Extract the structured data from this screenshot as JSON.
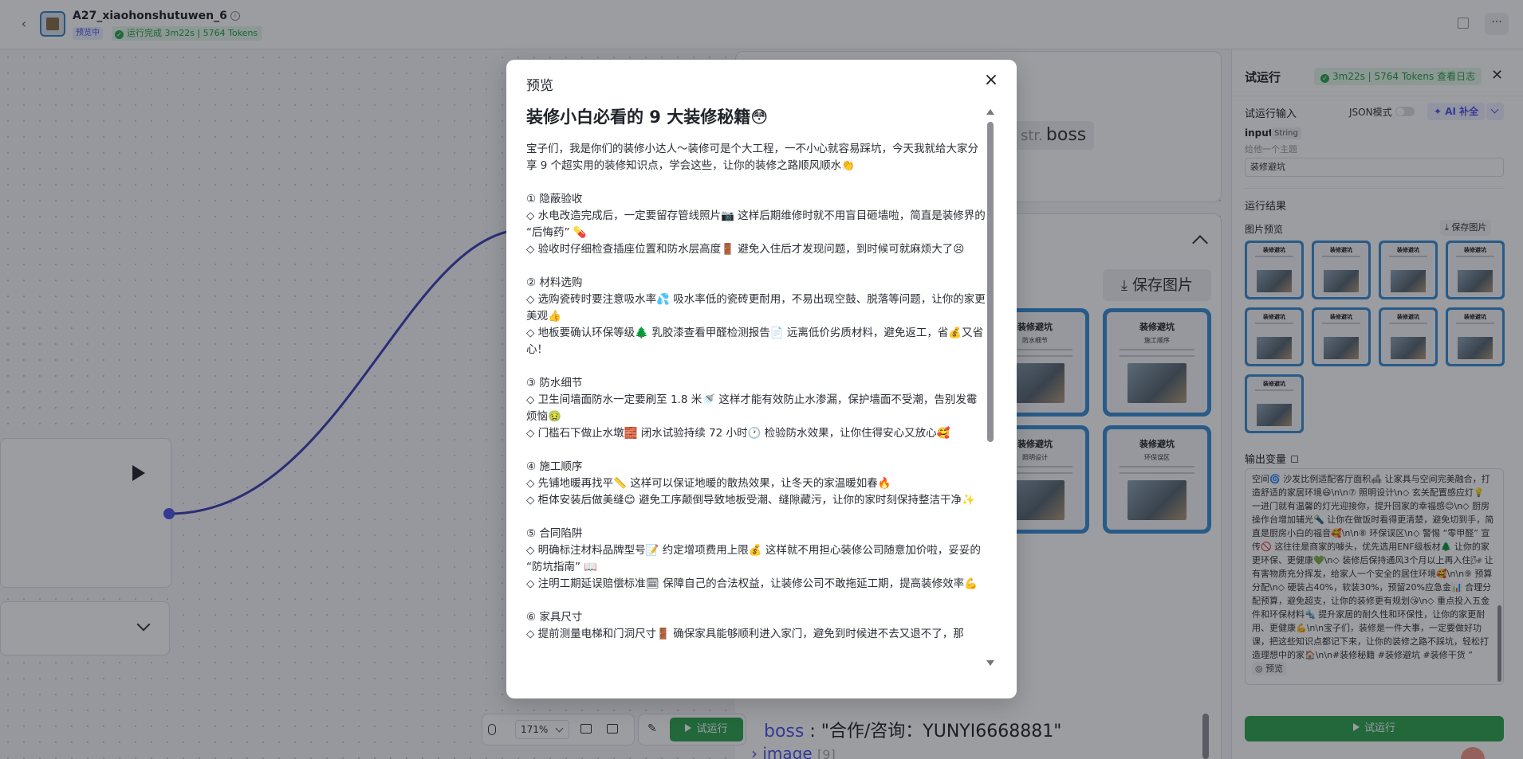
{
  "app": {
    "title": "A27_xiaohonshutuwen_6",
    "tag_preview": "预览中",
    "run_status": "运行完成 3m22s | 5764 Tokens"
  },
  "canvas": {
    "str_prefix": "str.",
    "str_value": "boss",
    "save_image_label": "保存图片",
    "boss_key": "boss",
    "boss_value": "\"合作/咨询：YUNYI6668881\"",
    "image_key": "image",
    "image_count": "[9]",
    "zoom": "171%",
    "run_label": "试运行",
    "thumb_title": "装修避坑",
    "thumbs": [
      {
        "sub": "防水细节"
      },
      {
        "sub": "施工顺序"
      },
      {
        "sub": "照明设计"
      },
      {
        "sub": "环保误区"
      }
    ]
  },
  "right_panel": {
    "title": "试运行",
    "badge": "3m22s | 5764 Tokens  查看日志",
    "input_label": "试运行输入",
    "json_mode": "JSON模式",
    "ai_button": "AI 补全",
    "var_name": "input",
    "var_type": "String",
    "var_hint": "给他一个主题",
    "var_value": "装修避坑",
    "result_title": "运行结果",
    "image_preview_label": "图片预览",
    "save_image_label": "保存图片",
    "thumb_title": "装修避坑",
    "output_var_label": "输出变量",
    "output_text": "空间🌀 沙发比例适配客厅面积🛋 让家具与空间完美融合，打造舒适的家居环境😄\\n\\n⑦ 照明设计\\n◇ 玄关配置感应灯💡 一进门就有温馨的灯光迎接你，提升回家的幸福感😊\\n◇ 厨房操作台增加辅光🔦 让你在做饭时看得更清楚，避免切到手，简直是厨房小白的福音🥰\\n\\n⑧ 环保误区\\n◇ 警惕 “零甲醛” 宣传🚫 这往往是商家的噱头，优先选用ENF级板材🌲 让你的家更环保、更健康💚\\n◇ 装修后保持通风3个月以上再入住🌬 让有害物质充分挥发，给家人一个安全的居住环境🥰\\n\\n⑨ 预算分配\\n◇ 硬装占40%，软装30%，预留20%应急金📊 合理分配预算，避免超支，让你的装修更有规划😘\\n◇ 重点投入五金件和环保材料🔩 提升家居的耐久性和环保性，让你的家更耐用、更健康💪\\n\\n宝子们，装修是一件大事，一定要做好功课，把这些知识点都记下来，让你的装修之路不踩坑，轻松打造理想中的家🏠\\n\\n#装修秘籍 #装修避坑 #装修干货 ”",
    "output_preview": "预览",
    "run_label": "试运行"
  },
  "modal": {
    "title": "预览",
    "article_title": "装修小白必看的 9 大装修秘籍😳",
    "paragraphs": [
      "宝子们，我是你们的装修小达人～装修可是个大工程，一不小心就容易踩坑，今天我就给大家分享 9 个超实用的装修知识点，学会这些，让你的装修之路顺风顺水👏",
      "",
      "① 隐蔽验收",
      "◇ 水电改造完成后，一定要留存管线照片📷 这样后期维修时就不用盲目砸墙啦，简直是装修界的 “后悔药” 💊",
      "◇ 验收时仔细检查插座位置和防水层高度🚪 避免入住后才发现问题，到时候可就麻烦大了😣",
      "",
      "② 材料选购",
      "◇ 选购瓷砖时要注意吸水率💦 吸水率低的瓷砖更耐用，不易出现空鼓、脱落等问题，让你的家更美观👍",
      "◇ 地板要确认环保等级🌲 乳胶漆查看甲醛检测报告📄 远离低价劣质材料，避免返工，省💰又省心！",
      "",
      "③ 防水细节",
      "◇ 卫生间墙面防水一定要刷至 1.8 米🚿 这样才能有效防止水渗漏，保护墙面不受潮，告别发霉烦恼🤢",
      "◇ 门槛石下做止水墩🧱 闭水试验持续 72 小时🕐 检验防水效果，让你住得安心又放心🥰",
      "",
      "④ 施工顺序",
      "◇ 先铺地暖再找平📏 这样可以保证地暖的散热效果，让冬天的家温暖如春🔥",
      "◇ 柜体安装后做美缝😊 避免工序颠倒导致地板受潮、缝隙藏污，让你的家时刻保持整洁干净✨",
      "",
      "⑤ 合同陷阱",
      "◇ 明确标注材料品牌型号📝 约定增项费用上限💰 这样就不用担心装修公司随意加价啦，妥妥的 “防坑指南” 📖",
      "◇ 注明工期延误赔偿标准🗓 保障自己的合法权益，让装修公司不敢拖延工期，提高装修效率💪",
      "",
      "⑥ 家具尺寸",
      "◇ 提前测量电梯和门洞尺寸🚪 确保家具能够顺利进入家门，避免到时候进不去又退不了，那"
    ]
  }
}
